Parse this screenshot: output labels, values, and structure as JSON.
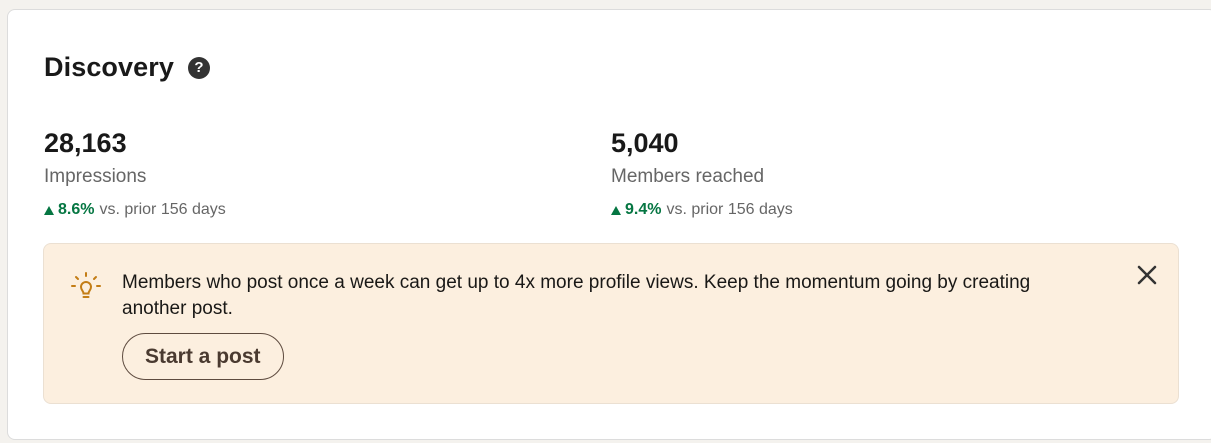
{
  "section": {
    "title": "Discovery",
    "help_icon": "help-circle-icon",
    "help_glyph": "?"
  },
  "metrics": [
    {
      "value": "28,163",
      "label": "Impressions",
      "trend_pct": "8.6%",
      "trend_text": "vs. prior 156 days",
      "trend_direction": "up"
    },
    {
      "value": "5,040",
      "label": "Members reached",
      "trend_pct": "9.4%",
      "trend_text": "vs. prior 156 days",
      "trend_direction": "up"
    }
  ],
  "banner": {
    "icon": "lightbulb-icon",
    "message": "Members who post once a week can get up to 4x more profile views. Keep the momentum going by creating another post.",
    "button_label": "Start a post",
    "close_icon": "close-icon"
  },
  "colors": {
    "trend_positive": "#057642",
    "banner_bg": "#fcefdf",
    "bulb": "#c37d16"
  }
}
